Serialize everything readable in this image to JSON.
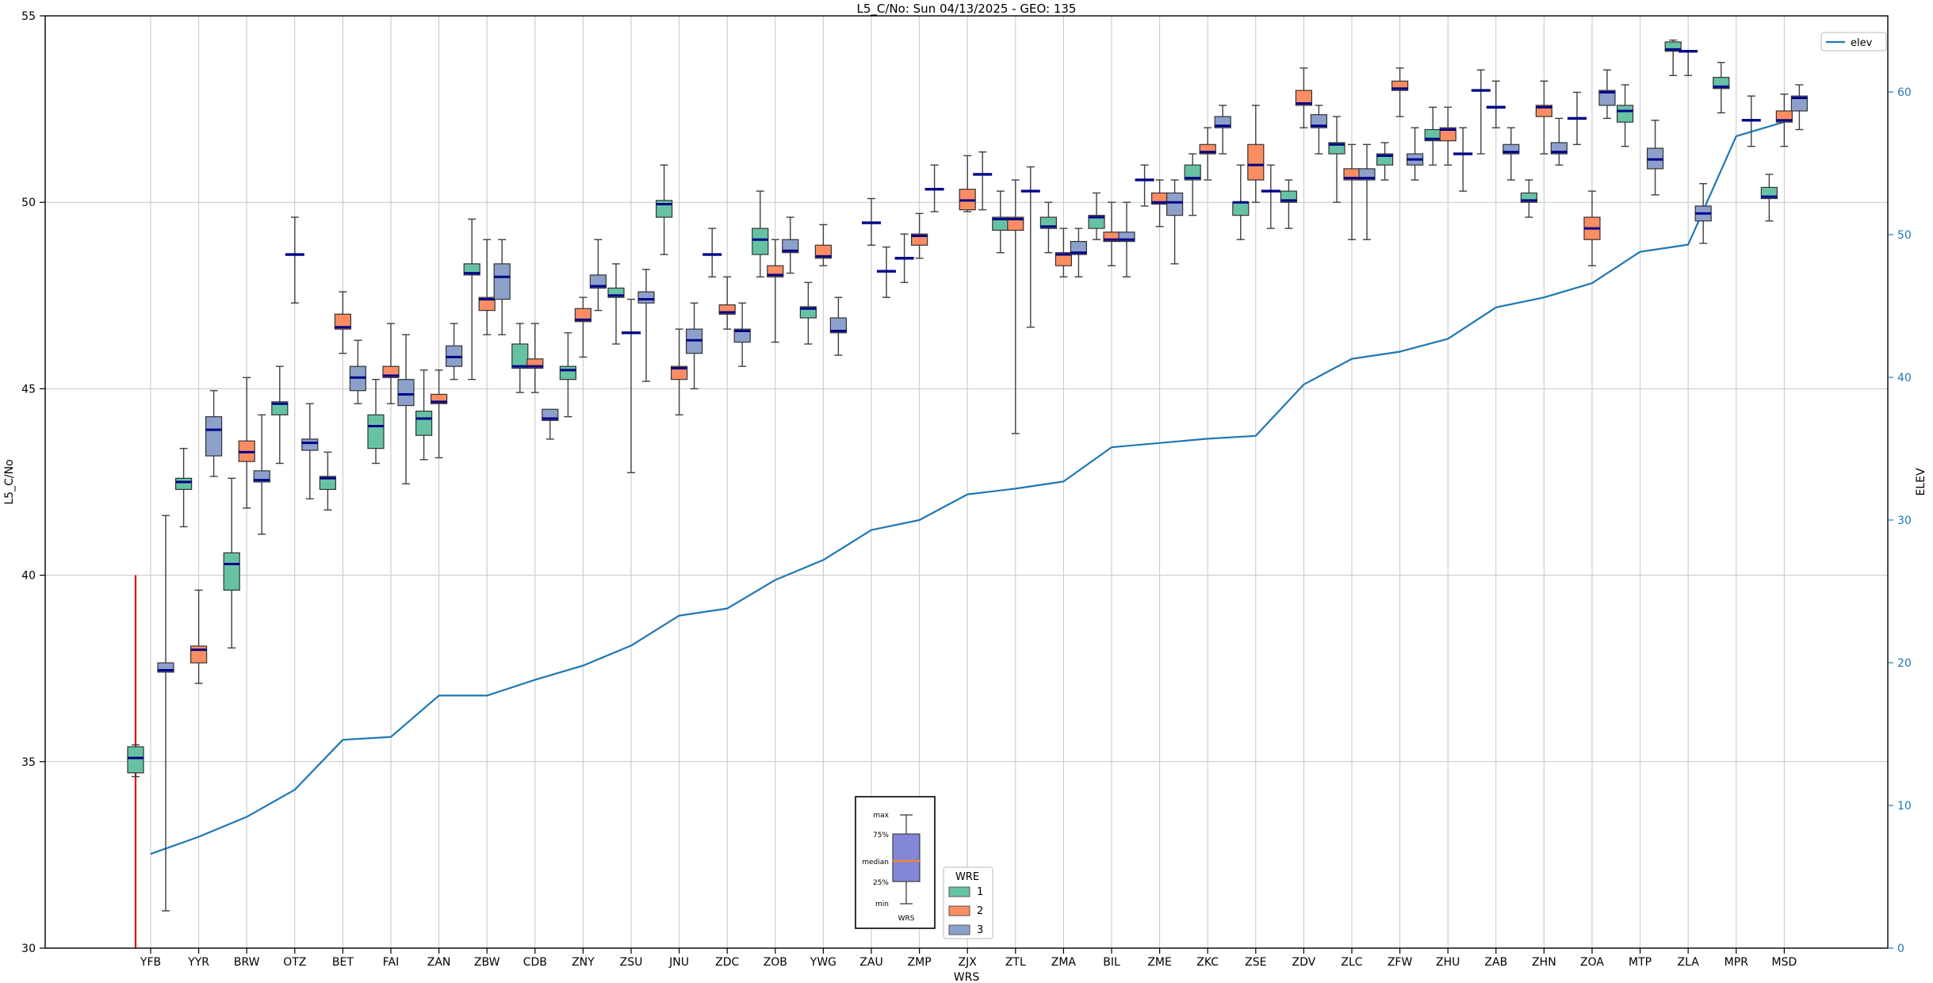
{
  "title": "L5_C/No: Sun 04/13/2025 - GEO: 135",
  "y_axis": {
    "label": "L5_C/No",
    "ticks": [
      30,
      35,
      40,
      45,
      50,
      55
    ],
    "range": [
      30,
      55
    ]
  },
  "y2_axis": {
    "label": "ELEV",
    "ticks": [
      0,
      10,
      20,
      30,
      40,
      50,
      60
    ],
    "color": "#1f77b4"
  },
  "x_axis": {
    "label": "WRS"
  },
  "legend_elev": {
    "label": "elev"
  },
  "legend_wre": {
    "title": "WRE",
    "entries": [
      {
        "label": "1",
        "color": "#66c2a5"
      },
      {
        "label": "2",
        "color": "#fc8d62"
      },
      {
        "label": "3",
        "color": "#8da0cb"
      }
    ]
  },
  "inset": {
    "labels": [
      "max",
      "75%",
      "median",
      "25%",
      "min"
    ],
    "xlabel": "WRS",
    "box_color": "#8486d8",
    "median_color": "#ef8536"
  },
  "chart_data": {
    "type": "box",
    "title": "L5_C/No: Sun 04/13/2025 - GEO: 135",
    "xlabel": "WRS",
    "ylabel": "L5_C/No",
    "y2label": "ELEV",
    "ylim": [
      30,
      55
    ],
    "y2lim": [
      0,
      65.3
    ],
    "grid": true,
    "median_color": "#00008b",
    "whisker_color": "#3f3f3f",
    "categories": [
      "YFB",
      "YYR",
      "BRW",
      "OTZ",
      "BET",
      "FAI",
      "ZAN",
      "ZBW",
      "CDB",
      "ZNY",
      "ZSU",
      "JNU",
      "ZDC",
      "ZOB",
      "YWG",
      "ZAU",
      "ZMP",
      "ZJX",
      "ZTL",
      "ZMA",
      "BIL",
      "ZME",
      "ZKC",
      "ZSE",
      "ZDV",
      "ZLC",
      "ZFW",
      "ZHU",
      "ZAB",
      "ZHN",
      "ZOA",
      "MTP",
      "ZLA",
      "MPR",
      "MSD"
    ],
    "box_stats_order": [
      "min",
      "q1",
      "median",
      "q3",
      "max"
    ],
    "series": [
      {
        "name": "1",
        "color": "#66c2a5",
        "boxes": [
          [
            34.6,
            34.7,
            35.1,
            35.4,
            35.45
          ],
          [
            41.3,
            42.3,
            42.5,
            42.6,
            43.4
          ],
          [
            38.05,
            39.6,
            40.3,
            40.6,
            42.6
          ],
          [
            43.0,
            44.3,
            44.6,
            44.65,
            45.6
          ],
          [
            41.75,
            42.3,
            42.6,
            42.65,
            43.3
          ],
          [
            43.0,
            43.4,
            44.0,
            44.3,
            45.25
          ],
          [
            43.1,
            43.75,
            44.2,
            44.4,
            45.5
          ],
          [
            45.25,
            48.05,
            48.1,
            48.35,
            49.55
          ],
          [
            44.9,
            45.55,
            45.6,
            46.2,
            46.75
          ],
          [
            44.25,
            45.25,
            45.5,
            45.6,
            46.5
          ],
          [
            46.2,
            47.45,
            47.5,
            47.7,
            48.35
          ],
          [
            48.6,
            49.6,
            49.95,
            50.05,
            51.0
          ],
          [
            48.0,
            48.6,
            48.6,
            48.6,
            49.3
          ],
          [
            48.0,
            48.6,
            49.0,
            49.3,
            50.3
          ],
          [
            46.2,
            46.9,
            47.15,
            47.2,
            47.85
          ],
          null,
          [
            47.85,
            48.5,
            48.5,
            48.5,
            49.15
          ],
          null,
          [
            48.65,
            49.25,
            49.55,
            49.6,
            50.3
          ],
          [
            48.65,
            49.3,
            49.35,
            49.6,
            50.0
          ],
          [
            49.0,
            49.3,
            49.6,
            49.65,
            50.25
          ],
          [
            49.9,
            50.6,
            50.6,
            50.6,
            51.0
          ],
          [
            49.65,
            50.6,
            50.65,
            51.0,
            51.3
          ],
          [
            49.0,
            49.65,
            50.0,
            50.0,
            51.0
          ],
          [
            49.3,
            50.0,
            50.05,
            50.3,
            50.6
          ],
          [
            50.0,
            51.3,
            51.55,
            51.6,
            52.3
          ],
          [
            50.6,
            51.0,
            51.25,
            51.3,
            51.6
          ],
          [
            51.0,
            51.65,
            51.7,
            51.95,
            52.55
          ],
          [
            51.3,
            53.0,
            53.0,
            53.0,
            53.55
          ],
          [
            49.6,
            50.0,
            50.05,
            50.25,
            50.6
          ],
          [
            51.55,
            52.25,
            52.25,
            52.25,
            52.95
          ],
          [
            51.5,
            52.15,
            52.45,
            52.6,
            53.15
          ],
          [
            53.4,
            54.05,
            54.1,
            54.3,
            54.35
          ],
          [
            52.4,
            53.05,
            53.1,
            53.35,
            53.75
          ],
          [
            49.5,
            50.1,
            50.15,
            50.4,
            50.75
          ]
        ]
      },
      {
        "name": "2",
        "color": "#fc8d62",
        "boxes": [
          null,
          [
            37.1,
            37.65,
            38.0,
            38.1,
            39.6
          ],
          [
            41.8,
            43.05,
            43.3,
            43.6,
            45.3
          ],
          [
            47.3,
            48.6,
            48.6,
            48.6,
            49.6
          ],
          [
            45.95,
            46.6,
            46.65,
            47.0,
            47.6
          ],
          [
            44.6,
            45.3,
            45.35,
            45.6,
            46.75
          ],
          [
            43.15,
            44.6,
            44.65,
            44.85,
            45.5
          ],
          [
            46.45,
            47.1,
            47.4,
            47.45,
            49.0
          ],
          [
            44.9,
            45.55,
            45.6,
            45.8,
            46.75
          ],
          [
            45.85,
            46.8,
            46.85,
            47.15,
            47.45
          ],
          [
            42.75,
            46.5,
            46.5,
            46.5,
            47.4
          ],
          [
            44.3,
            45.25,
            45.55,
            45.6,
            46.6
          ],
          [
            46.6,
            47.0,
            47.05,
            47.25,
            48.0
          ],
          [
            46.25,
            48.0,
            48.05,
            48.3,
            49.0
          ],
          [
            48.3,
            48.5,
            48.55,
            48.85,
            49.4
          ],
          [
            48.85,
            49.45,
            49.45,
            49.45,
            50.1
          ],
          [
            48.5,
            48.85,
            49.1,
            49.15,
            49.7
          ],
          [
            49.75,
            49.8,
            50.05,
            50.35,
            51.25
          ],
          [
            43.8,
            49.25,
            49.55,
            49.6,
            50.6
          ],
          [
            48.0,
            48.3,
            48.6,
            48.65,
            49.3
          ],
          [
            48.3,
            48.95,
            49.0,
            49.2,
            50.0
          ],
          [
            49.35,
            49.95,
            50.0,
            50.25,
            50.6
          ],
          [
            50.6,
            51.3,
            51.35,
            51.55,
            52.0
          ],
          [
            50.0,
            50.6,
            51.0,
            51.55,
            52.6
          ],
          [
            52.0,
            52.6,
            52.65,
            53.0,
            53.6
          ],
          [
            49.0,
            50.6,
            50.65,
            50.9,
            51.55
          ],
          [
            52.3,
            53.0,
            53.05,
            53.25,
            53.6
          ],
          [
            51.0,
            51.65,
            51.95,
            52.0,
            52.55
          ],
          [
            52.0,
            52.55,
            52.55,
            52.55,
            53.25
          ],
          [
            51.3,
            52.3,
            52.55,
            52.6,
            53.25
          ],
          [
            48.3,
            49.0,
            49.3,
            49.6,
            50.3
          ],
          null,
          [
            53.4,
            54.05,
            54.05,
            54.05,
            54.05
          ],
          null,
          [
            51.5,
            52.15,
            52.2,
            52.45,
            52.9
          ]
        ]
      },
      {
        "name": "3",
        "color": "#8da0cb",
        "boxes": [
          [
            31.0,
            37.4,
            37.45,
            37.65,
            41.6
          ],
          [
            42.65,
            43.2,
            43.9,
            44.25,
            44.95
          ],
          [
            41.1,
            42.5,
            42.55,
            42.8,
            44.3
          ],
          [
            42.05,
            43.35,
            43.55,
            43.65,
            44.6
          ],
          [
            44.6,
            44.95,
            45.3,
            45.6,
            46.3
          ],
          [
            42.45,
            44.55,
            44.85,
            45.25,
            46.45
          ],
          [
            45.25,
            45.6,
            45.85,
            46.15,
            46.75
          ],
          [
            46.45,
            47.4,
            48.0,
            48.35,
            49.0
          ],
          [
            43.65,
            44.15,
            44.2,
            44.45,
            44.45
          ],
          [
            47.1,
            47.7,
            47.75,
            48.05,
            49.0
          ],
          [
            45.2,
            47.3,
            47.4,
            47.6,
            48.2
          ],
          [
            45.0,
            45.95,
            46.3,
            46.6,
            47.3
          ],
          [
            45.6,
            46.25,
            46.55,
            46.6,
            47.3
          ],
          [
            48.1,
            48.65,
            48.7,
            49.0,
            49.6
          ],
          [
            45.9,
            46.5,
            46.55,
            46.9,
            47.45
          ],
          [
            47.45,
            48.15,
            48.15,
            48.15,
            48.8
          ],
          [
            49.75,
            50.35,
            50.35,
            50.35,
            51.0
          ],
          [
            49.8,
            50.75,
            50.75,
            50.75,
            51.35
          ],
          [
            46.65,
            50.3,
            50.3,
            50.3,
            50.95
          ],
          [
            48.0,
            48.6,
            48.65,
            48.95,
            49.3
          ],
          [
            48.0,
            48.95,
            49.0,
            49.2,
            50.0
          ],
          [
            48.35,
            49.65,
            50.0,
            50.25,
            50.6
          ],
          [
            51.3,
            52.0,
            52.05,
            52.3,
            52.6
          ],
          [
            49.3,
            50.3,
            50.3,
            50.3,
            51.0
          ],
          [
            51.3,
            52.0,
            52.05,
            52.35,
            52.6
          ],
          [
            49.0,
            50.6,
            50.65,
            50.9,
            51.55
          ],
          [
            50.6,
            51.0,
            51.15,
            51.3,
            52.0
          ],
          [
            50.3,
            51.3,
            51.3,
            51.3,
            52.0
          ],
          [
            50.6,
            51.3,
            51.35,
            51.55,
            52.0
          ],
          [
            51.0,
            51.3,
            51.35,
            51.6,
            52.25
          ],
          [
            52.25,
            52.6,
            52.95,
            53.0,
            53.55
          ],
          [
            50.2,
            50.9,
            51.15,
            51.45,
            52.2
          ],
          [
            48.9,
            49.5,
            49.7,
            49.9,
            50.5
          ],
          [
            51.5,
            52.2,
            52.2,
            52.2,
            52.85
          ],
          [
            51.95,
            52.45,
            52.8,
            52.85,
            53.15
          ]
        ]
      }
    ],
    "elev_line": {
      "name": "elev",
      "color": "#1f77b4",
      "values": [
        6.6,
        7.8,
        9.2,
        11.1,
        14.6,
        14.8,
        17.7,
        17.7,
        18.8,
        19.8,
        21.2,
        23.3,
        23.8,
        25.8,
        27.2,
        29.3,
        30.0,
        31.8,
        32.2,
        32.7,
        35.1,
        35.4,
        35.7,
        35.9,
        39.5,
        41.3,
        41.8,
        42.7,
        44.9,
        45.6,
        46.6,
        48.8,
        49.3,
        56.9,
        57.9
      ]
    },
    "red_line": {
      "category": "YFB",
      "series": "1",
      "value_from": 30,
      "value_to": 40,
      "color": "#e50000"
    }
  }
}
